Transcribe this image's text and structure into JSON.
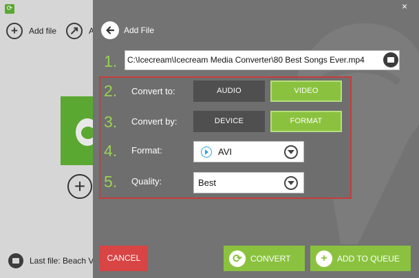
{
  "background": {
    "add_file_label": "Add file",
    "second_button_label": "A",
    "last_file_label": "Last file: Beach Vi"
  },
  "panel": {
    "title": "Add File",
    "close_glyph": "×",
    "file_path": "C:\\Icecream\\Icecream Media Converter\\80 Best Songs Ever.mp4"
  },
  "steps": {
    "s1": "1.",
    "s2": "2.",
    "s3": "3.",
    "s4": "4.",
    "s5": "5."
  },
  "options": {
    "convert_to_label": "Convert to:",
    "convert_to_audio": "AUDIO",
    "convert_to_video": "VIDEO",
    "convert_by_label": "Convert by:",
    "convert_by_device": "DEVICE",
    "convert_by_format": "FORMAT",
    "format_label": "Format:",
    "format_value": "AVI",
    "quality_label": "Quality:",
    "quality_value": "Best"
  },
  "actions": {
    "cancel_label": "CANCEL",
    "convert_label": "CONVERT",
    "queue_label": "ADD TO QUEUE"
  },
  "colors": {
    "accent_green": "#8ac23f",
    "step_green": "#9bd251",
    "cancel_red": "#d94444",
    "frame_red": "#c83c3c",
    "panel_gray": "#737373"
  },
  "icons": {
    "back": "arrow-left-icon",
    "folder": "folder-icon",
    "dropdown": "chevron-down-icon",
    "play": "play-icon",
    "convert": "refresh-icon",
    "queue": "plus-icon"
  }
}
